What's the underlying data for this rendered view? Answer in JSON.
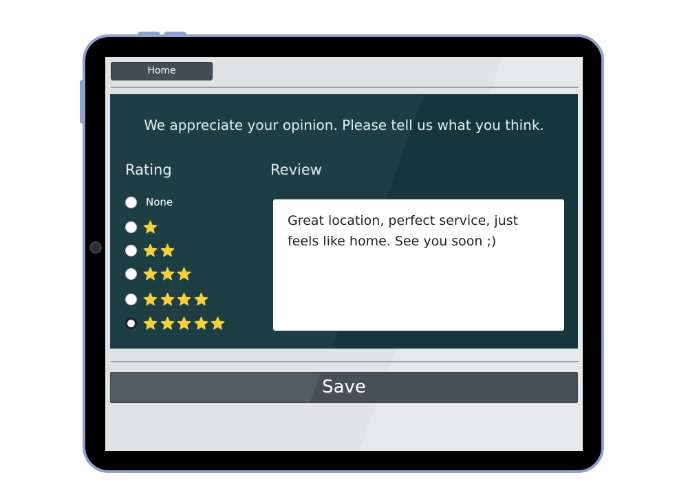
{
  "nav": {
    "home_label": "Home"
  },
  "feedback": {
    "message": "We appreciate your opinion. Please tell us what you think.",
    "rating_title": "Rating",
    "review_title": "Review",
    "rating_options": [
      {
        "label": "None",
        "stars": 0,
        "selected": false
      },
      {
        "label": "",
        "stars": 1,
        "selected": false
      },
      {
        "label": "",
        "stars": 2,
        "selected": false
      },
      {
        "label": "",
        "stars": 3,
        "selected": false
      },
      {
        "label": "",
        "stars": 4,
        "selected": false
      },
      {
        "label": "",
        "stars": 5,
        "selected": true
      }
    ],
    "selected_rating": 5,
    "review_text": "Great location, perfect service, just feels like home. See you soon ;)"
  },
  "actions": {
    "save_label": "Save"
  },
  "colors": {
    "tablet_frame": "#8ea2cf",
    "panel": "#1d3f44",
    "star": "#f7ce3e",
    "save_button": "#4d575c"
  },
  "icons": {
    "rating_star": "star-icon"
  }
}
